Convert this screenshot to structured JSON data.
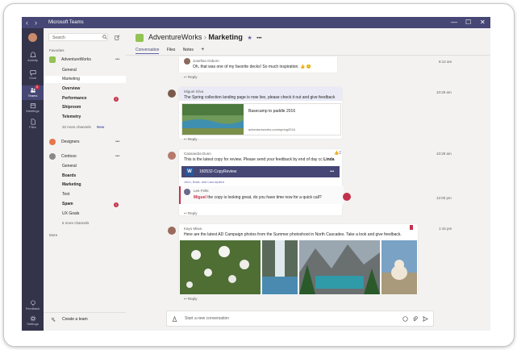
{
  "window": {
    "title": "Microsoft Teams",
    "back": "‹",
    "forward": "›",
    "minimize": "—",
    "maximize": "☐",
    "close": "✕"
  },
  "rail": {
    "items": [
      {
        "label": "Activity"
      },
      {
        "label": "Chat"
      },
      {
        "label": "Teams",
        "badge": "2"
      },
      {
        "label": "Meetings"
      },
      {
        "label": "Files"
      }
    ],
    "bottom": [
      {
        "label": "Feedback"
      },
      {
        "label": "Settings"
      }
    ]
  },
  "sidebar": {
    "search_placeholder": "Search",
    "favorites_label": "Favorites",
    "teams": [
      {
        "name": "AdventureWorks",
        "more": "•••",
        "channels": [
          {
            "name": "General"
          },
          {
            "name": "Marketing",
            "selected": true
          },
          {
            "name": "Overview",
            "bold": true
          },
          {
            "name": "Performance",
            "bold": true,
            "count": "1"
          },
          {
            "name": "Shiproom",
            "bold": true
          },
          {
            "name": "Telemetry",
            "bold": true
          }
        ],
        "more_channels": "32 more channels",
        "new_label": "New"
      },
      {
        "name": "Designers",
        "more": "•••"
      },
      {
        "name": "Contoso",
        "more": "•••",
        "channels": [
          {
            "name": "General"
          },
          {
            "name": "Boards",
            "bold": true
          },
          {
            "name": "Marketing",
            "bold": true
          },
          {
            "name": "Test"
          },
          {
            "name": "Spam",
            "bold": true,
            "count": "1"
          },
          {
            "name": "UX Goals"
          }
        ],
        "more_channels": "6 more channels"
      }
    ],
    "more_label": "More",
    "create_team": "Create a team"
  },
  "channel": {
    "team": "AdventureWorks",
    "separator": "›",
    "name": "Marketing",
    "star": "★",
    "more": "•••",
    "tabs": [
      "Conversation",
      "Files",
      "Notes"
    ],
    "add_tab": "+"
  },
  "messages": [
    {
      "author": "Josefina Osborn",
      "text": "Oh, that was one of my favorite decks! So much inspiration. 👍 😊",
      "time": "8:12 am",
      "reply": "Reply"
    },
    {
      "author": "Miguel Silva",
      "text": "The Spring collection landing page is now live, please check it out and give feedback",
      "time": "10:29 am",
      "card_title": "Basecamp to paddle 2016",
      "card_url": "adventureworks.com/spring2016",
      "reply": "Reply"
    },
    {
      "author": "Cassandra Dunn",
      "text_prefix": "This is the latest copy for review. Please send your feedback by end of day cc ",
      "mention": "Linda",
      "time": "10:29 am",
      "likes": "2",
      "file_name": "160532-CopyReview",
      "file_more": "•••",
      "replied": "John, Brad, and Lisa replied",
      "sub_author": "Lee Felts",
      "sub_mention": "Miguel",
      "sub_text": " the copy is looking great, do you have time now for a quick call?",
      "sub_time": "12:00 pm",
      "reply": "Reply"
    },
    {
      "author": "Kayo Miwa",
      "text": "Here are the latest AD Campaign photos from the Summer photoshoot in North Cascades. Take a look and give feedback.",
      "time": "1:15 pm",
      "reply": "Reply"
    }
  ],
  "compose": {
    "placeholder": "Start a new conversation"
  }
}
